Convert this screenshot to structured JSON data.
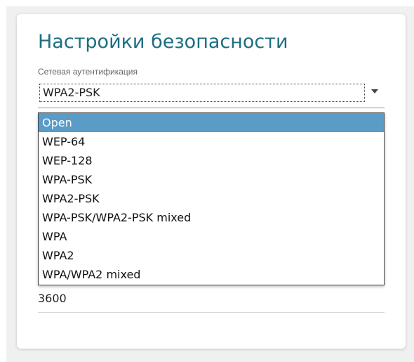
{
  "section": {
    "title": "Настройки безопасности"
  },
  "auth": {
    "label": "Сетевая аутентификация",
    "selected": "WPA2-PSK",
    "highlighted_option": "Open",
    "options": [
      "Open",
      "WEP-64",
      "WEP-128",
      "WPA-PSK",
      "WPA2-PSK",
      "WPA-PSK/WPA2-PSK mixed",
      "WPA",
      "WPA2",
      "WPA/WPA2 mixed"
    ]
  },
  "field_value": "3600",
  "colors": {
    "title": "#1d6e82",
    "highlight": "#5b9bc8"
  },
  "icons": {
    "select_arrow": "chevron-down-icon"
  }
}
